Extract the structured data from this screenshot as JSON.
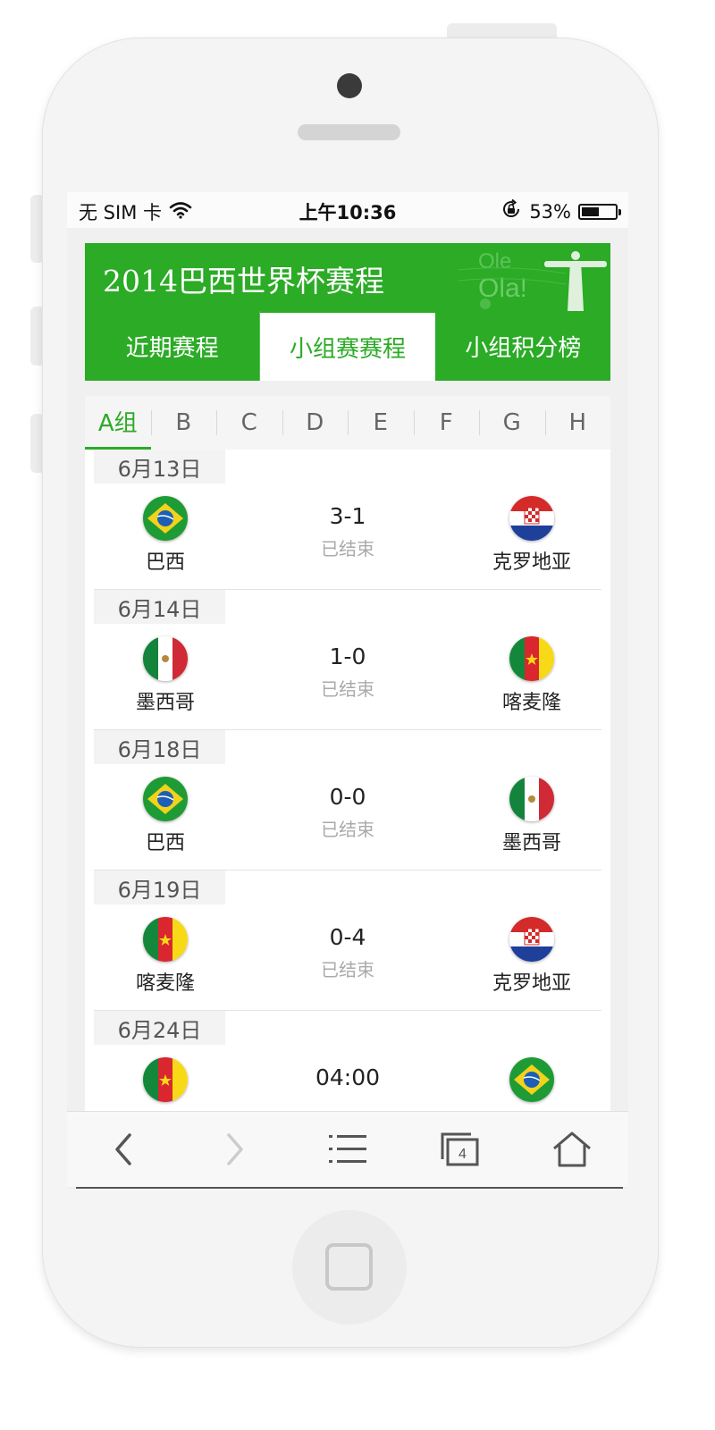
{
  "status_bar": {
    "carrier": "无 SIM 卡",
    "time": "上午10:36",
    "battery_percent": "53%",
    "battery_level": 0.53
  },
  "header": {
    "title": "2014巴西世界杯赛程",
    "deco_text_1": "Ole",
    "deco_text_2": "Ola!"
  },
  "tabs": [
    {
      "label": "近期赛程",
      "active": false
    },
    {
      "label": "小组赛赛程",
      "active": true
    },
    {
      "label": "小组积分榜",
      "active": false
    }
  ],
  "groups": [
    "A组",
    "B",
    "C",
    "D",
    "E",
    "F",
    "G",
    "H"
  ],
  "matches": [
    {
      "date": "6月13日",
      "home": "巴西",
      "home_flag": "brazil-flag-icon",
      "score": "3-1",
      "status": "已结束",
      "away": "克罗地亚",
      "away_flag": "croatia-flag-icon"
    },
    {
      "date": "6月14日",
      "home": "墨西哥",
      "home_flag": "mexico-flag-icon",
      "score": "1-0",
      "status": "已结束",
      "away": "喀麦隆",
      "away_flag": "cameroon-flag-icon"
    },
    {
      "date": "6月18日",
      "home": "巴西",
      "home_flag": "brazil-flag-icon",
      "score": "0-0",
      "status": "已结束",
      "away": "墨西哥",
      "away_flag": "mexico-flag-icon"
    },
    {
      "date": "6月19日",
      "home": "喀麦隆",
      "home_flag": "cameroon-flag-icon",
      "score": "0-4",
      "status": "已结束",
      "away": "克罗地亚",
      "away_flag": "croatia-flag-icon"
    },
    {
      "date": "6月24日",
      "home": "",
      "home_flag": "cameroon-flag-icon",
      "score": "04:00",
      "status": "",
      "away": "",
      "away_flag": "brazil-flag-icon"
    }
  ],
  "toolbar": {
    "tabs_count": "4",
    "icons": [
      "back-arrow-icon",
      "forward-arrow-icon",
      "menu-list-icon",
      "tabs-icon",
      "home-icon"
    ]
  },
  "colors": {
    "brand_green": "#2bab26",
    "phone_body": "#f4f4f4",
    "inactive_text": "#aaaaaa"
  }
}
